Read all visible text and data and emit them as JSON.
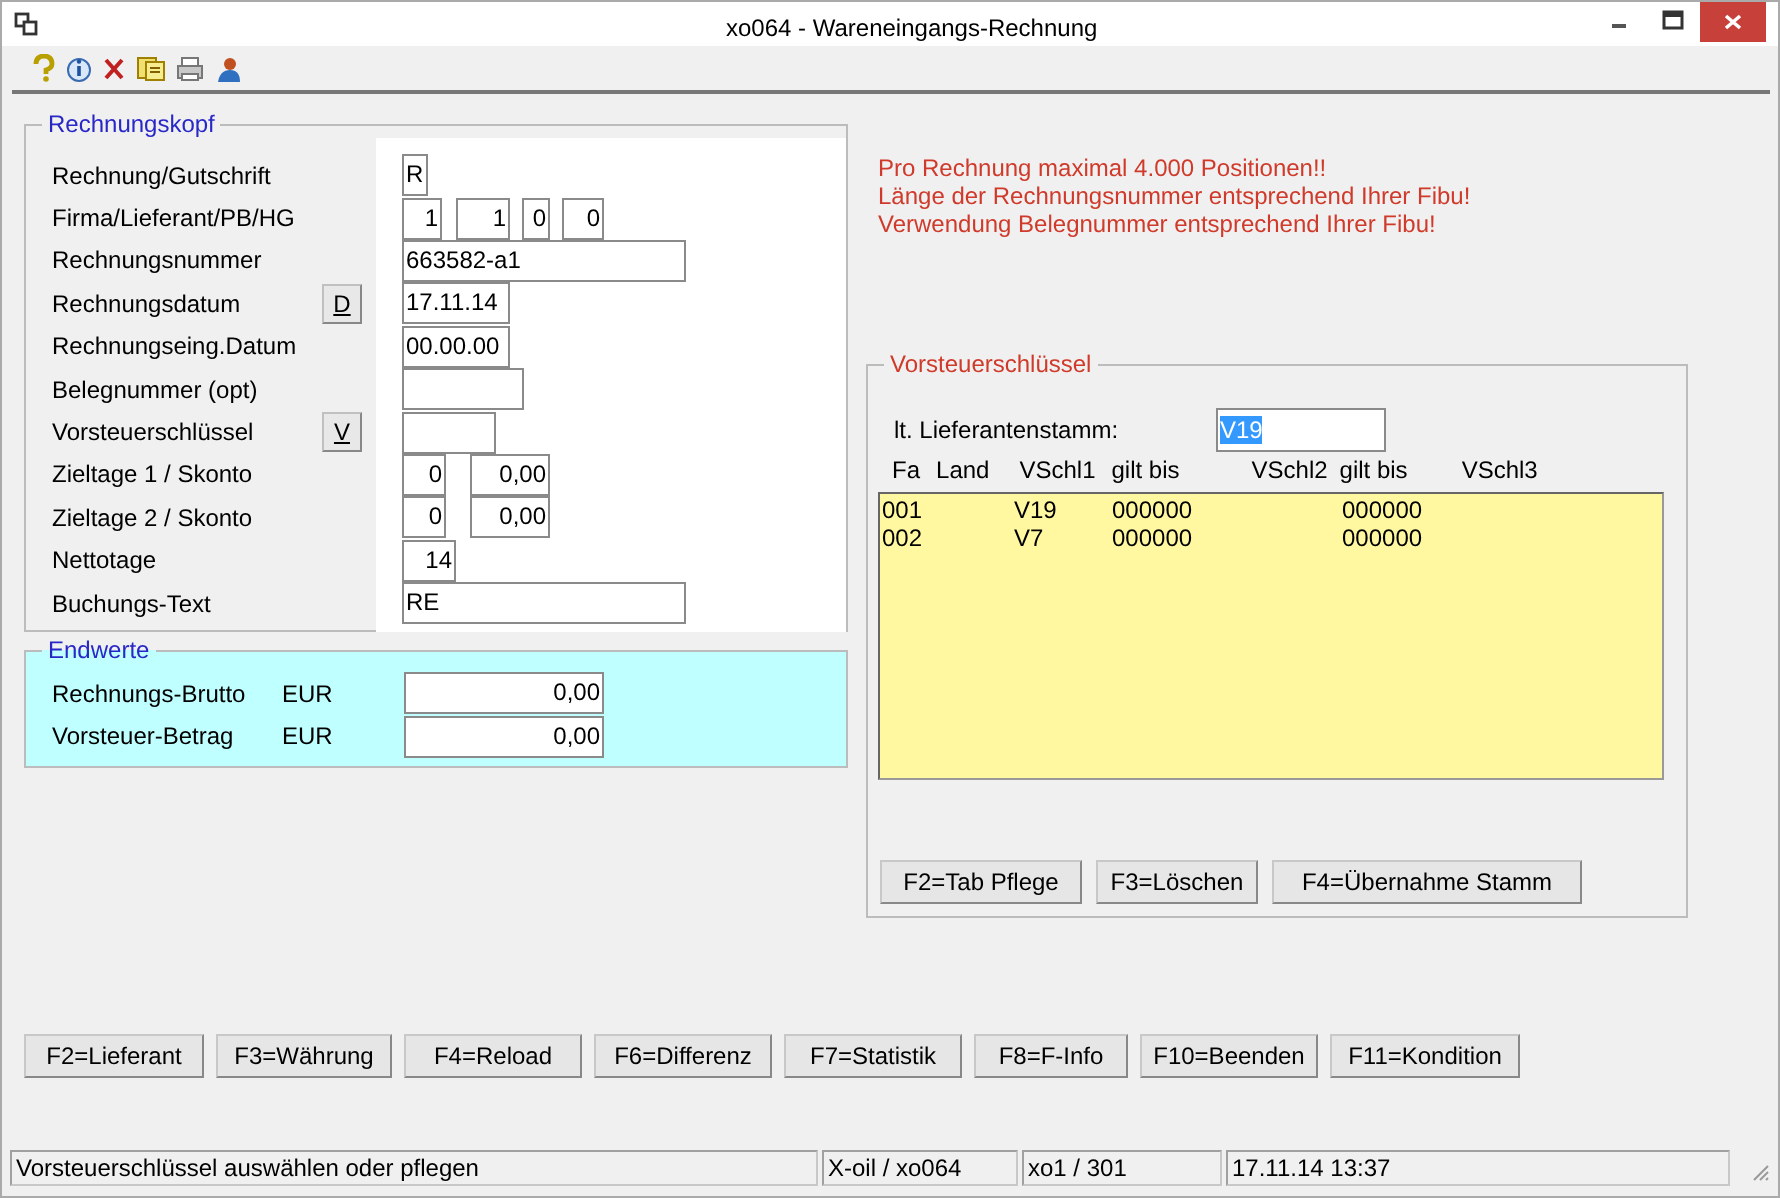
{
  "window": {
    "title": "xo064 - Wareneingangs-Rechnung"
  },
  "rechnungskopf": {
    "title": "Rechnungskopf",
    "rows": [
      {
        "label": "Rechnung/Gutschrift",
        "fields": [
          "R"
        ]
      },
      {
        "label": "Firma/Lieferant/PB/HG",
        "fields": [
          "1",
          "1",
          "0",
          "0"
        ]
      },
      {
        "label": "Rechnungsnummer",
        "fields": [
          "663582-a1"
        ]
      },
      {
        "label": "Rechnungsdatum",
        "button": "D",
        "fields": [
          "17.11.14"
        ]
      },
      {
        "label": "Rechnungseing.Datum",
        "fields": [
          "00.00.00"
        ]
      },
      {
        "label": "Belegnummer (opt)",
        "fields": []
      },
      {
        "label": "Vorsteuerschlüssel",
        "button": "V",
        "fields": []
      },
      {
        "label": "Zieltage 1 / Skonto",
        "fields": [
          "0",
          "0,00"
        ]
      },
      {
        "label": "Zieltage 2 / Skonto",
        "fields": [
          "0",
          "0,00"
        ]
      },
      {
        "label": "Nettotage",
        "fields": [
          "14"
        ]
      },
      {
        "label": "Buchungs-Text",
        "fields": [
          "RE"
        ]
      }
    ]
  },
  "endwerte": {
    "title": "Endwerte",
    "rows": [
      {
        "label": "Rechnungs-Brutto",
        "currency": "EUR",
        "value": "0,00"
      },
      {
        "label": "Vorsteuer-Betrag",
        "currency": "EUR",
        "value": "0,00"
      }
    ]
  },
  "notices": [
    "Pro Rechnung maximal 4.000 Positionen!!",
    "Länge der Rechnungsnummer entsprechend Ihrer Fibu!",
    "Verwendung Belegnummer entsprechend Ihrer Fibu!"
  ],
  "vorsteuer": {
    "title": "Vorsteuerschlüssel",
    "lieferant_label": "lt. Lieferantenstamm:",
    "lieferant_value": "V19",
    "value_selected": true,
    "columns": [
      "Fa",
      "Land",
      "VSchl1",
      "gilt bis",
      "VSchl2",
      "gilt bis",
      "VSchl3"
    ],
    "rows": [
      {
        "fa": "001",
        "vschl1": "V19",
        "gilt_bis_1": "000000",
        "gilt_bis_2": "000000"
      },
      {
        "fa": "002",
        "vschl1": "V7",
        "gilt_bis_1": "000000",
        "gilt_bis_2": "000000"
      }
    ],
    "buttons": [
      "F2=Tab Pflege",
      "F3=Löschen",
      "F4=Übernahme Stamm"
    ]
  },
  "function_keys": [
    "F2=Lieferant",
    "F3=Währung",
    "F4=Reload",
    "F6=Differenz",
    "F7=Statistik",
    "F8=F-Info",
    "F10=Beenden",
    "F11=Kondition"
  ],
  "status_bar": [
    "Vorsteuerschlüssel auswählen oder pflegen",
    "X-oil / xo064",
    "xo1 / 301",
    "17.11.14 13:37"
  ]
}
